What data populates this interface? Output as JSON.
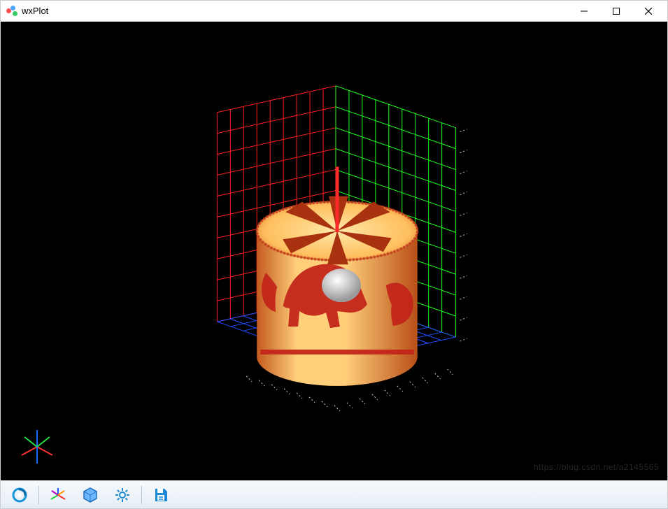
{
  "window": {
    "title": "wxPlot"
  },
  "watermark": "https://blog.csdn.net/a2145565",
  "toolbar": {
    "buttons": [
      {
        "name": "reset-view-button",
        "icon": "swirl-icon"
      },
      {
        "name": "axes-toggle-button",
        "icon": "axes-star-icon"
      },
      {
        "name": "shape-button",
        "icon": "hexagon-icon"
      },
      {
        "name": "settings-button",
        "icon": "gear-icon"
      },
      {
        "name": "save-button",
        "icon": "save-icon"
      }
    ]
  },
  "chart_data": {
    "type": "area",
    "title": "",
    "description": "3D textured cylinder (lantern) with fan blades on top, rendered inside a wireframe box with colored grid walls and axis tick marks.",
    "axes": {
      "x": {
        "range": [
          -5,
          5
        ],
        "grid_color": "#ff0000",
        "ticks": [
          -5,
          -4,
          -3,
          -2,
          -1,
          0,
          1,
          2,
          3,
          4,
          5
        ]
      },
      "y": {
        "range": [
          -5,
          5
        ],
        "grid_color": "#00ff00",
        "ticks": [
          -5,
          -4,
          -3,
          -2,
          -1,
          0,
          1,
          2,
          3,
          4,
          5
        ]
      },
      "z": {
        "range": [
          0,
          10
        ],
        "grid_color": "#0000ff",
        "ticks": [
          0,
          1,
          2,
          3,
          4,
          5,
          6,
          7,
          8,
          9,
          10
        ]
      }
    },
    "cylinder": {
      "radius": 3,
      "height": 6,
      "center": [
        0,
        0,
        3
      ],
      "texture": "chinese-zodiac-horse-papercut",
      "color_top": "#ffd98a",
      "color_side_light": "#ffc972",
      "color_side_dark": "#e07a2f",
      "pattern_color": "#c3261a"
    },
    "fan": {
      "blades": 6,
      "blade_color": "#a8320f",
      "spindle_color": "#ff2a2a",
      "spindle_height": 2
    },
    "inner_sphere": {
      "radius": 0.8,
      "color": "#eeeeee"
    },
    "camera": {
      "azimuth_deg": 35,
      "elevation_deg": 35
    }
  }
}
